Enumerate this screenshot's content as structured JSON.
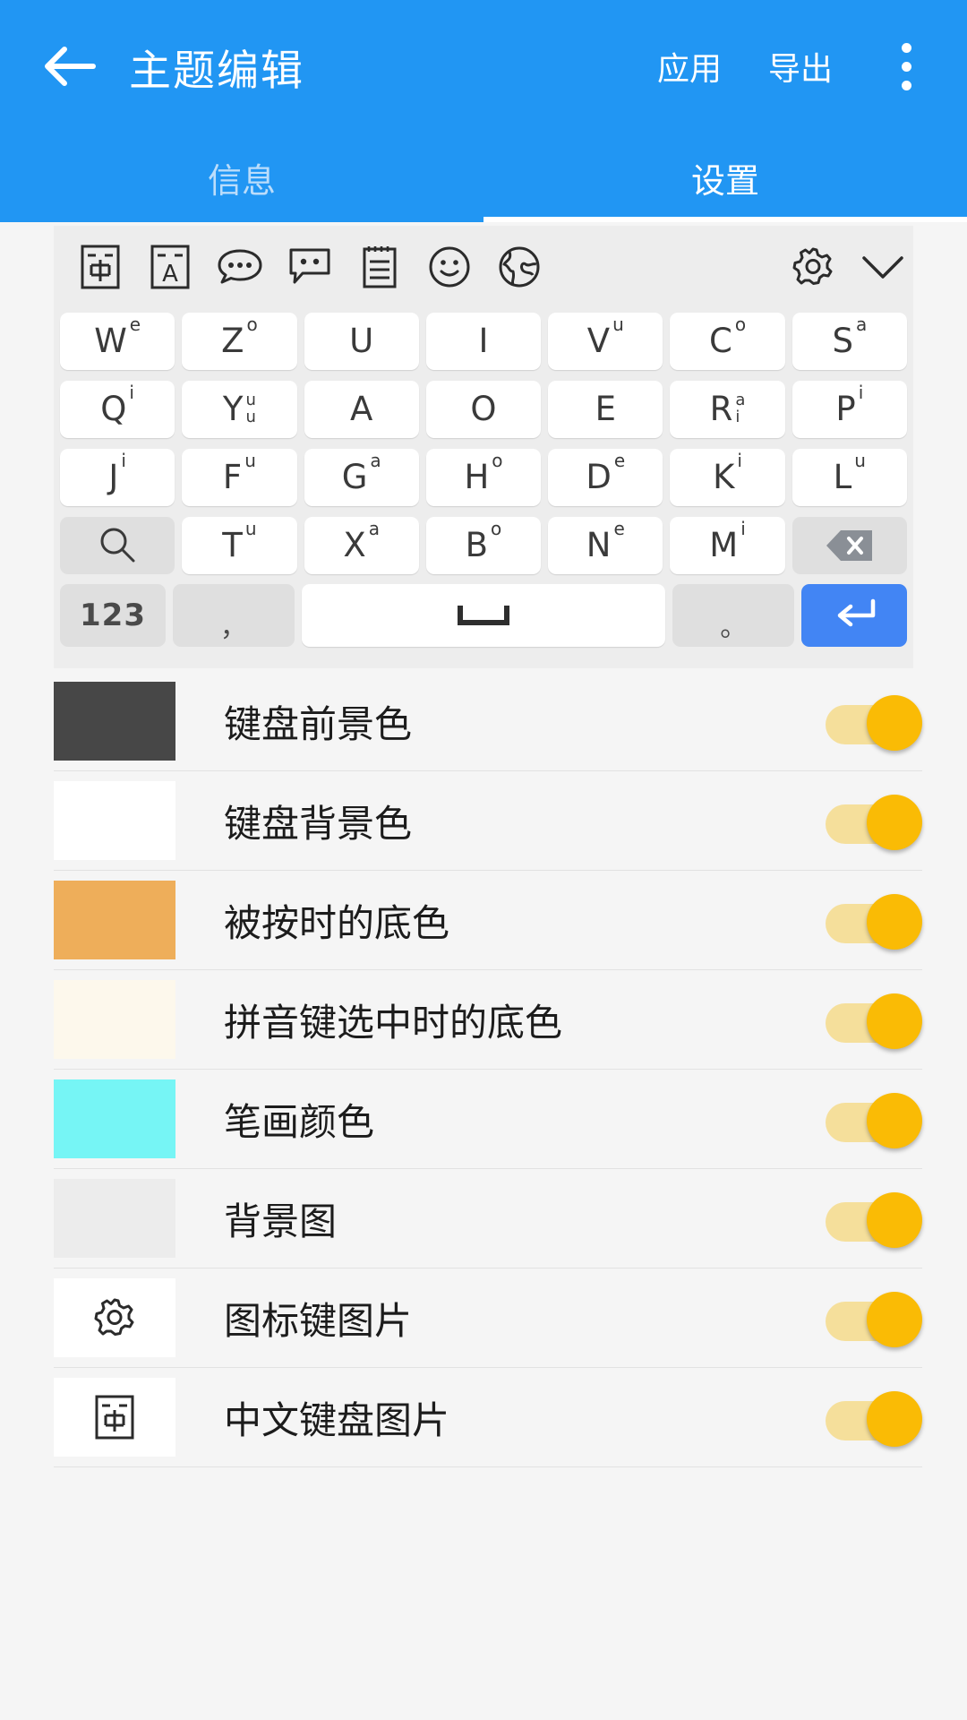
{
  "appbar": {
    "back_icon": "arrow-left-icon",
    "title": "主题编辑",
    "apply_label": "应用",
    "export_label": "导出",
    "overflow_icon": "more-vertical-icon"
  },
  "tabs": [
    {
      "label": "信息",
      "active": false
    },
    {
      "label": "设置",
      "active": true
    }
  ],
  "colors": {
    "accent": "#2196F3",
    "toggle_thumb": "#FABB05",
    "toggle_track": "#F5DF9B",
    "page_bg": "#F5F5F5",
    "keyboard_bg": "#EDEDED",
    "enter_key": "#4285F4"
  },
  "keyboard": {
    "toolbar": [
      {
        "name": "chinese-input-icon",
        "glyph": "中"
      },
      {
        "name": "english-input-icon",
        "glyph": "A"
      },
      {
        "name": "speech-bubble-icon",
        "glyph": "…"
      },
      {
        "name": "chat-bubble-icon",
        "glyph": ".."
      },
      {
        "name": "clipboard-icon",
        "glyph": "≡"
      },
      {
        "name": "emoji-icon",
        "glyph": "☺"
      },
      {
        "name": "globe-icon",
        "glyph": "◍"
      },
      {
        "name": "gear-icon",
        "glyph": "⚙"
      },
      {
        "name": "chevron-down-icon",
        "glyph": "⌄"
      }
    ],
    "rows": [
      [
        {
          "base": "W",
          "sup": "e"
        },
        {
          "base": "Z",
          "sup": "o"
        },
        {
          "base": "U",
          "sup": ""
        },
        {
          "base": "I",
          "sup": ""
        },
        {
          "base": "V",
          "sup": "u"
        },
        {
          "base": "C",
          "sup": "o"
        },
        {
          "base": "S",
          "sup": "a"
        }
      ],
      [
        {
          "base": "Q",
          "sup": "i"
        },
        {
          "base": "Y",
          "stack": [
            "u",
            "u"
          ]
        },
        {
          "base": "A",
          "sup": ""
        },
        {
          "base": "O",
          "sup": ""
        },
        {
          "base": "E",
          "sup": ""
        },
        {
          "base": "R",
          "stack": [
            "a",
            "i"
          ]
        },
        {
          "base": "P",
          "sup": "i"
        }
      ],
      [
        {
          "base": "J",
          "sup": "i"
        },
        {
          "base": "F",
          "sup": "u"
        },
        {
          "base": "G",
          "sup": "a"
        },
        {
          "base": "H",
          "sup": "o"
        },
        {
          "base": "D",
          "sup": "e"
        },
        {
          "base": "K",
          "sup": "i"
        },
        {
          "base": "L",
          "sup": "u"
        }
      ],
      [
        {
          "icon": "search-icon"
        },
        {
          "base": "T",
          "sup": "u"
        },
        {
          "base": "X",
          "sup": "a"
        },
        {
          "base": "B",
          "sup": "o"
        },
        {
          "base": "N",
          "sup": "e"
        },
        {
          "base": "M",
          "sup": "i"
        },
        {
          "icon": "backspace-icon"
        }
      ]
    ],
    "bottom_row": {
      "numbers_label": "123",
      "comma_label": "，",
      "space_icon": "space-bar-icon",
      "period_label": "。",
      "enter_icon": "enter-icon"
    }
  },
  "settings": {
    "items": [
      {
        "label": "键盘前景色",
        "swatch_color": "#474747",
        "swatch_kind": "color",
        "toggle_on": true
      },
      {
        "label": "键盘背景色",
        "swatch_color": "#FFFFFF",
        "swatch_kind": "color",
        "toggle_on": true
      },
      {
        "label": "被按时的底色",
        "swatch_color": "#EEAE5A",
        "swatch_kind": "color",
        "toggle_on": true
      },
      {
        "label": "拼音键选中时的底色",
        "swatch_color": "#FDF8EC",
        "swatch_kind": "color",
        "toggle_on": true
      },
      {
        "label": "笔画颜色",
        "swatch_color": "#76F5F5",
        "swatch_kind": "color",
        "toggle_on": true
      },
      {
        "label": "背景图",
        "swatch_color": "#ECECEC",
        "swatch_kind": "image",
        "toggle_on": true
      },
      {
        "label": "图标键图片",
        "swatch_color": "#FFFFFF",
        "swatch_kind": "gear-icon",
        "toggle_on": true
      },
      {
        "label": "中文键盘图片",
        "swatch_color": "#FFFFFF",
        "swatch_kind": "chinese-input-icon",
        "toggle_on": true
      }
    ]
  }
}
